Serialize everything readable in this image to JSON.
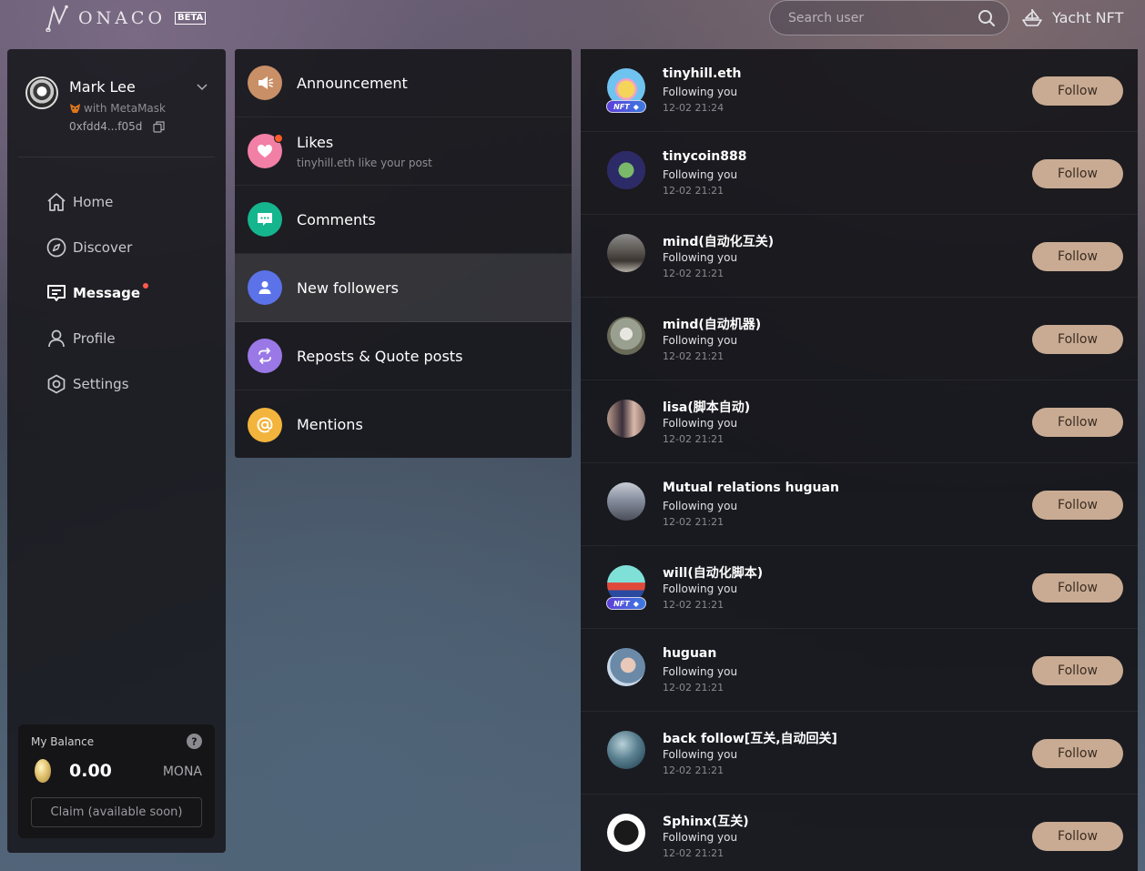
{
  "header": {
    "logo_text": "ONACO",
    "beta_label": "BETA",
    "search_placeholder": "Search user",
    "yacht_label": "Yacht NFT"
  },
  "user": {
    "name": "Mark Lee",
    "wallet": "with MetaMask",
    "address": "0xfdd4...f05d"
  },
  "nav": {
    "items": [
      {
        "label": "Home",
        "icon": "home-icon"
      },
      {
        "label": "Discover",
        "icon": "compass-icon"
      },
      {
        "label": "Message",
        "icon": "message-icon",
        "active": true,
        "dot": true
      },
      {
        "label": "Profile",
        "icon": "person-icon"
      },
      {
        "label": "Settings",
        "icon": "settings-icon"
      }
    ]
  },
  "balance": {
    "label": "My Balance",
    "value": "0.00",
    "unit": "MONA",
    "claim_label": "Claim (available soon)"
  },
  "categories": [
    {
      "title": "Announcement",
      "icon": "megaphone-icon",
      "color": "#c98f67"
    },
    {
      "title": "Likes",
      "subtitle": "tinyhill.eth like your post",
      "icon": "heart-icon",
      "color": "#f27fa5",
      "dot": true
    },
    {
      "title": "Comments",
      "icon": "comment-icon",
      "color": "#15b58e"
    },
    {
      "title": "New followers",
      "icon": "user-icon",
      "color": "#5b72e8",
      "active": true
    },
    {
      "title": "Reposts & Quote posts",
      "icon": "repost-icon",
      "color": "#9a78e6"
    },
    {
      "title": "Mentions",
      "icon": "at-icon",
      "color": "#f2b43c"
    }
  ],
  "followers": {
    "follow_label": "Follow",
    "status_text": "Following you",
    "nft_label": "NFT",
    "items": [
      {
        "name": "tinyhill.eth",
        "time": "12-02 21:24",
        "nft": true
      },
      {
        "name": "tinycoin888",
        "time": "12-02 21:21",
        "nft": false
      },
      {
        "name": "mind(自动化互关)",
        "time": "12-02 21:21",
        "nft": false
      },
      {
        "name": "mind(自动机器)",
        "time": "12-02 21:21",
        "nft": false
      },
      {
        "name": "lisa(脚本自动)",
        "time": "12-02 21:21",
        "nft": false
      },
      {
        "name": "Mutual relations huguan",
        "time": "12-02 21:21",
        "nft": false
      },
      {
        "name": "will(自动化脚本)",
        "time": "12-02 21:21",
        "nft": true
      },
      {
        "name": "huguan",
        "time": "12-02 21:21",
        "nft": false
      },
      {
        "name": "back follow[互关,自动回关]",
        "time": "12-02 21:21",
        "nft": false
      },
      {
        "name": "Sphinx(互关)",
        "time": "12-02 21:21",
        "nft": false
      }
    ]
  },
  "colors": {
    "follow_button": "#c9ab93",
    "notification_dot": "#ff5b4d"
  }
}
